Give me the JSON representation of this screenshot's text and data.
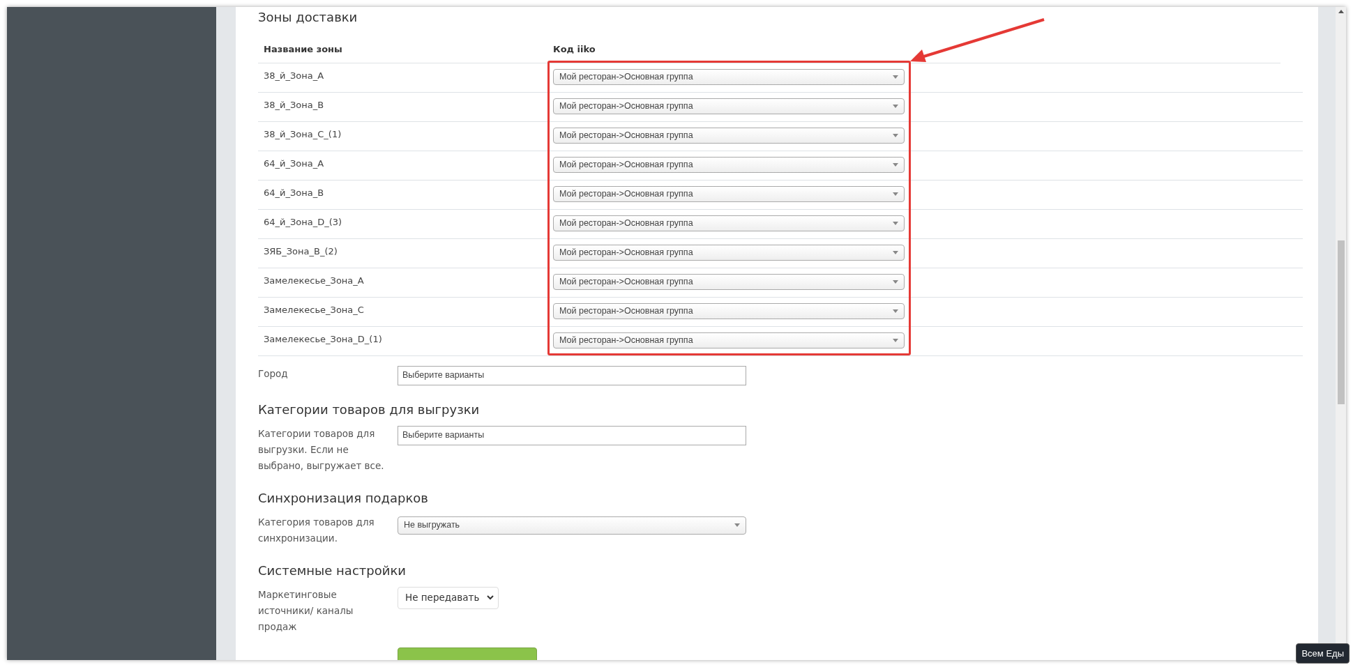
{
  "delivery_zones": {
    "title": "Зоны доставки",
    "columns": [
      "Название зоны",
      "Код iiko"
    ],
    "rows": [
      {
        "zone": "38_й_Зона_А",
        "code": "Мой ресторан->Основная группа"
      },
      {
        "zone": "38_й_Зона_В",
        "code": "Мой ресторан->Основная группа"
      },
      {
        "zone": "38_й_Зона_С_(1)",
        "code": "Мой ресторан->Основная группа"
      },
      {
        "zone": "64_й_Зона_А",
        "code": "Мой ресторан->Основная группа"
      },
      {
        "zone": "64_й_Зона_В",
        "code": "Мой ресторан->Основная группа"
      },
      {
        "zone": "64_й_Зона_D_(3)",
        "code": "Мой ресторан->Основная группа"
      },
      {
        "zone": "ЗЯБ_Зона_В_(2)",
        "code": "Мой ресторан->Основная группа"
      },
      {
        "zone": "Замелекесье_Зона_А",
        "code": "Мой ресторан->Основная группа"
      },
      {
        "zone": "Замелекесье_Зона_С",
        "code": "Мой ресторан->Основная группа"
      },
      {
        "zone": "Замелекесье_Зона_D_(1)",
        "code": "Мой ресторан->Основная группа"
      }
    ]
  },
  "city": {
    "label": "Город",
    "placeholder": "Выберите варианты"
  },
  "sections": [
    {
      "title": "Категории товаров для выгрузки",
      "label": "Категории товаров для выгрузки. Если не выбрано, выгружает все.",
      "kind": "multiselect",
      "placeholder": "Выберите варианты"
    },
    {
      "title": "Синхронизация подарков",
      "label": "Категория товаров для синхронизации.",
      "kind": "dropdown",
      "value": "Не выгружать"
    },
    {
      "title": "Системные настройки",
      "label": "Маркетинговые источники/ каналы продаж",
      "kind": "select",
      "value": "Не передавать"
    }
  ],
  "tooltip": "Всем Еды"
}
